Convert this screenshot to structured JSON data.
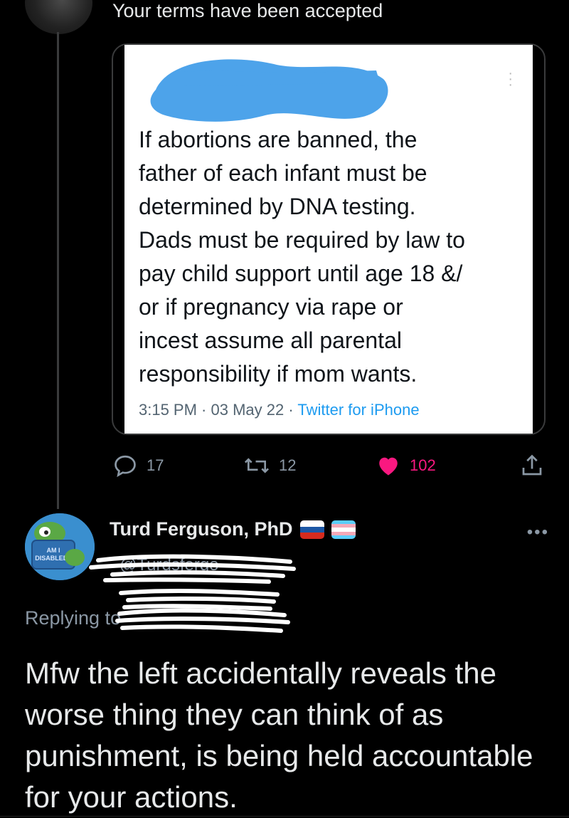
{
  "top": {
    "status_text": "Your terms have been accepted"
  },
  "embedded_tweet": {
    "body": "If abortions are banned, the\nfather of each infant must be\ndetermined by DNA testing.\nDads must be required by law to\npay child support until age 18 &/\nor if pregnancy via rape or\nincest assume all parental\nresponsibility if mom wants.",
    "time": "3:15 PM · 03 May 22 · ",
    "source": "Twitter for iPhone",
    "author_redacted": true
  },
  "actions": {
    "replies": "17",
    "retweets": "12",
    "likes": "102",
    "like_color": "#f91880"
  },
  "reply": {
    "name": "Turd Ferguson, PhD",
    "handle": "@Turdsfergo",
    "replying_prefix": "Replying to",
    "body": "Mfw the left accidentally reveals the worse thing they can think of as punishment, is being held accountable for your actions.",
    "avatar_text": "AM I DISABLED?"
  },
  "colors": {
    "background": "#000000",
    "text": "#e7e9ea",
    "muted": "#8b98a5",
    "link": "#1d9bf0",
    "redaction_blue": "#4da3ea"
  }
}
